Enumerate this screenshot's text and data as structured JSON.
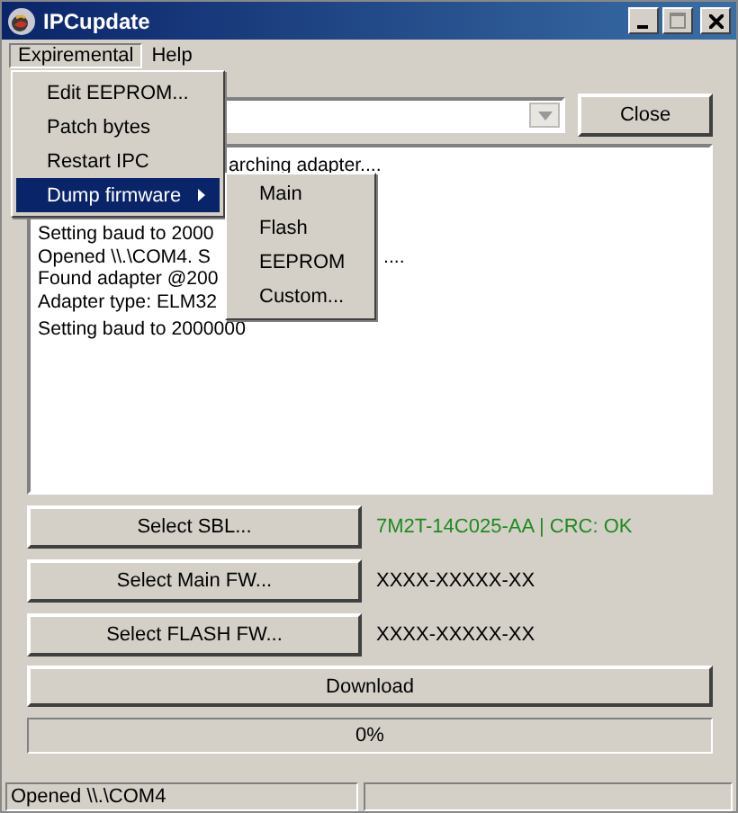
{
  "window": {
    "title": "IPCupdate"
  },
  "menubar": [
    {
      "label": "Expiremental",
      "selected": true
    },
    {
      "label": "Help",
      "selected": false
    }
  ],
  "menu": [
    {
      "label": "Edit EEPROM...",
      "selected": false,
      "submenu": false
    },
    {
      "label": "Patch bytes",
      "selected": false,
      "submenu": false
    },
    {
      "label": "Restart IPC",
      "selected": false,
      "submenu": false
    },
    {
      "label": "Dump firmware",
      "selected": true,
      "submenu": true
    }
  ],
  "submenu": [
    "Main",
    "Flash",
    "EEPROM",
    "Custom..."
  ],
  "close_button": "Close",
  "log": [
    {
      "tail": "arching adapter...."
    },
    {
      "text": "Setting baud to 2000"
    },
    {
      "text": "Opened \\\\.\\COM4. S",
      "tail": "...."
    },
    {
      "text": "Found adapter @200"
    },
    {
      "text": "Adapter type: ELM32"
    },
    {
      "text": "Setting baud to 2000000"
    }
  ],
  "firmware": [
    {
      "button": "Select SBL...",
      "value": "7M2T-14C025-AA | CRC: OK",
      "ok": true
    },
    {
      "button": "Select Main FW...",
      "value": "XXXX-XXXXX-XX",
      "ok": false
    },
    {
      "button": "Select FLASH FW...",
      "value": "XXXX-XXXXX-XX",
      "ok": false
    }
  ],
  "download_button": "Download",
  "progress": {
    "reading": "0%"
  },
  "status_bar": [
    "Opened \\\\.\\COM4"
  ]
}
